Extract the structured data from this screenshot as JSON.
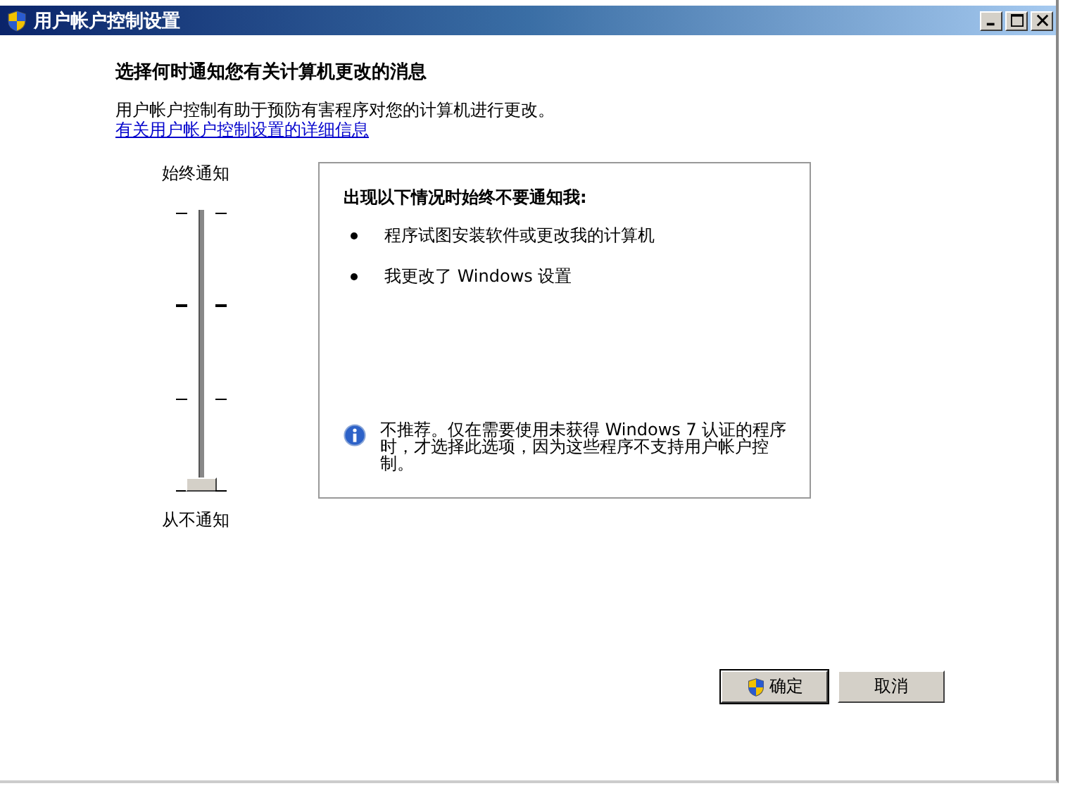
{
  "window": {
    "title": "用户帐户控制设置"
  },
  "heading": "选择何时通知您有关计算机更改的消息",
  "description": "用户帐户控制有助于预防有害程序对您的计算机进行更改。",
  "help_link": "有关用户帐户控制设置的详细信息",
  "slider": {
    "top_label": "始终通知",
    "bottom_label": "从不通知",
    "level": 0
  },
  "info_panel": {
    "title": "出现以下情况时始终不要通知我:",
    "bullets": [
      "程序试图安装软件或更改我的计算机",
      "我更改了 Windows 设置"
    ],
    "note": "不推荐。仅在需要使用未获得 Windows 7 认证的程序时，才选择此选项，因为这些程序不支持用户帐户控制。"
  },
  "buttons": [
    {
      "label": "确定",
      "kind": "shield"
    },
    {
      "label": "取消",
      "kind": "plain"
    }
  ]
}
